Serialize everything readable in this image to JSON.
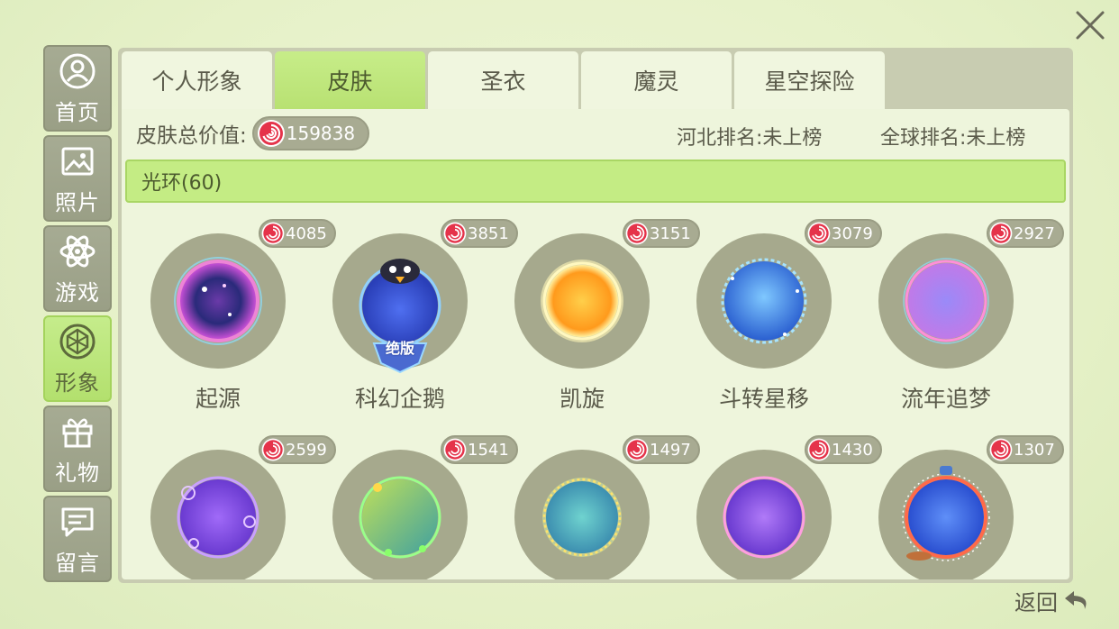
{
  "nav": [
    {
      "label": "首页",
      "icon": "profile-icon"
    },
    {
      "label": "照片",
      "icon": "photo-icon"
    },
    {
      "label": "游戏",
      "icon": "atom-icon"
    },
    {
      "label": "形象",
      "icon": "gem-icon",
      "active": true
    },
    {
      "label": "礼物",
      "icon": "gift-icon"
    },
    {
      "label": "留言",
      "icon": "message-icon"
    }
  ],
  "tabs": [
    {
      "label": "个人形象"
    },
    {
      "label": "皮肤",
      "active": true
    },
    {
      "label": "圣衣"
    },
    {
      "label": "魔灵"
    },
    {
      "label": "星空探险"
    }
  ],
  "summary": {
    "total_label": "皮肤总价值:",
    "total_value": "159838",
    "hebei_rank": "河北排名:未上榜",
    "global_rank": "全球排名:未上榜"
  },
  "section": {
    "title": "光环(60)"
  },
  "items": [
    {
      "name": "起源",
      "price": "4085",
      "colors": [
        "#3a2a8a",
        "#c74fd6",
        "#6ad0ff"
      ]
    },
    {
      "name": "科幻企鹅",
      "price": "3851",
      "colors": [
        "#3f5fe0",
        "#2a3fb8",
        "#8fd0ff"
      ],
      "badge": "绝版"
    },
    {
      "name": "凯旋",
      "price": "3151",
      "colors": [
        "#ffb12a",
        "#ff8a1c",
        "#fff1a0"
      ]
    },
    {
      "name": "斗转星移",
      "price": "3079",
      "colors": [
        "#3f8ff2",
        "#2a5fd0",
        "#a7e4ff"
      ]
    },
    {
      "name": "流年追梦",
      "price": "2927",
      "colors": [
        "#9a6cf0",
        "#c07ae8",
        "#ff8fd8"
      ]
    },
    {
      "name": "",
      "price": "2599",
      "colors": [
        "#8a4ff0",
        "#6a3ad0",
        "#c9a0ff"
      ]
    },
    {
      "name": "",
      "price": "1541",
      "colors": [
        "#8fd35a",
        "#3fa0a0",
        "#ffd84a"
      ]
    },
    {
      "name": "",
      "price": "1497",
      "colors": [
        "#5fc3c0",
        "#3d8fb0",
        "#ffe36a"
      ]
    },
    {
      "name": "",
      "price": "1430",
      "colors": [
        "#9a5ff0",
        "#6a3ad0",
        "#ff9ee0"
      ]
    },
    {
      "name": "",
      "price": "1307",
      "colors": [
        "#3f6ff0",
        "#2a4fd0",
        "#ff6a4a"
      ]
    }
  ],
  "back_label": "返回"
}
